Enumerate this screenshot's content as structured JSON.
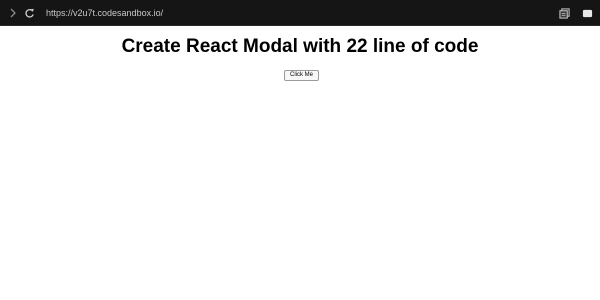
{
  "browser": {
    "url": "https://v2u7t.codesandbox.io/",
    "icons": {
      "forward": "chevron-right-icon",
      "refresh": "refresh-icon",
      "copy": "copy-icon",
      "preview": "preview-window-icon"
    },
    "bar_color": "#151515",
    "url_color": "#c8c8c8"
  },
  "main": {
    "title": "Create React Modal with 22 line of code",
    "button_label": "Click Me"
  }
}
